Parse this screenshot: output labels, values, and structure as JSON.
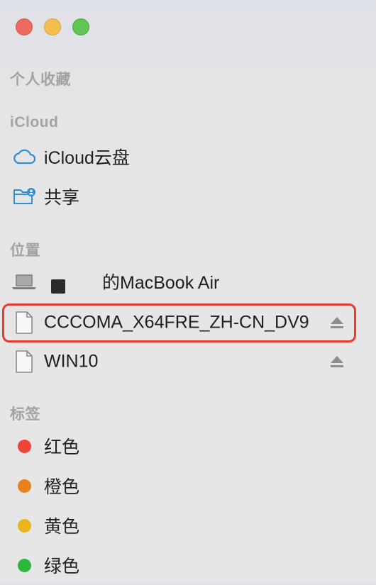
{
  "window": {
    "buttons": [
      "close",
      "minimize",
      "zoom"
    ]
  },
  "sections": {
    "favorites": {
      "title": "个人收藏"
    },
    "icloud": {
      "title": "iCloud",
      "items": [
        {
          "label": "iCloud云盘",
          "icon": "cloud-icon"
        },
        {
          "label": "共享",
          "icon": "shared-folder-icon"
        }
      ]
    },
    "locations": {
      "title": "位置",
      "items": [
        {
          "label": "的MacBook Air",
          "icon": "laptop-icon"
        },
        {
          "label": "CCCOMA_X64FRE_ZH-CN_DV9",
          "icon": "document-icon",
          "ejectable": true,
          "highlighted": true
        },
        {
          "label": "WIN10",
          "icon": "document-icon",
          "ejectable": true
        }
      ]
    },
    "tags": {
      "title": "标签",
      "items": [
        {
          "label": "红色",
          "color": "#f0443a"
        },
        {
          "label": "橙色",
          "color": "#e8831c"
        },
        {
          "label": "黄色",
          "color": "#eab51a"
        },
        {
          "label": "绿色",
          "color": "#2cb83e"
        }
      ]
    }
  },
  "colors": {
    "accent_cloud": "#2f8fd4",
    "highlight_border": "#e53c2e",
    "section_title": "#a3a3a6"
  }
}
